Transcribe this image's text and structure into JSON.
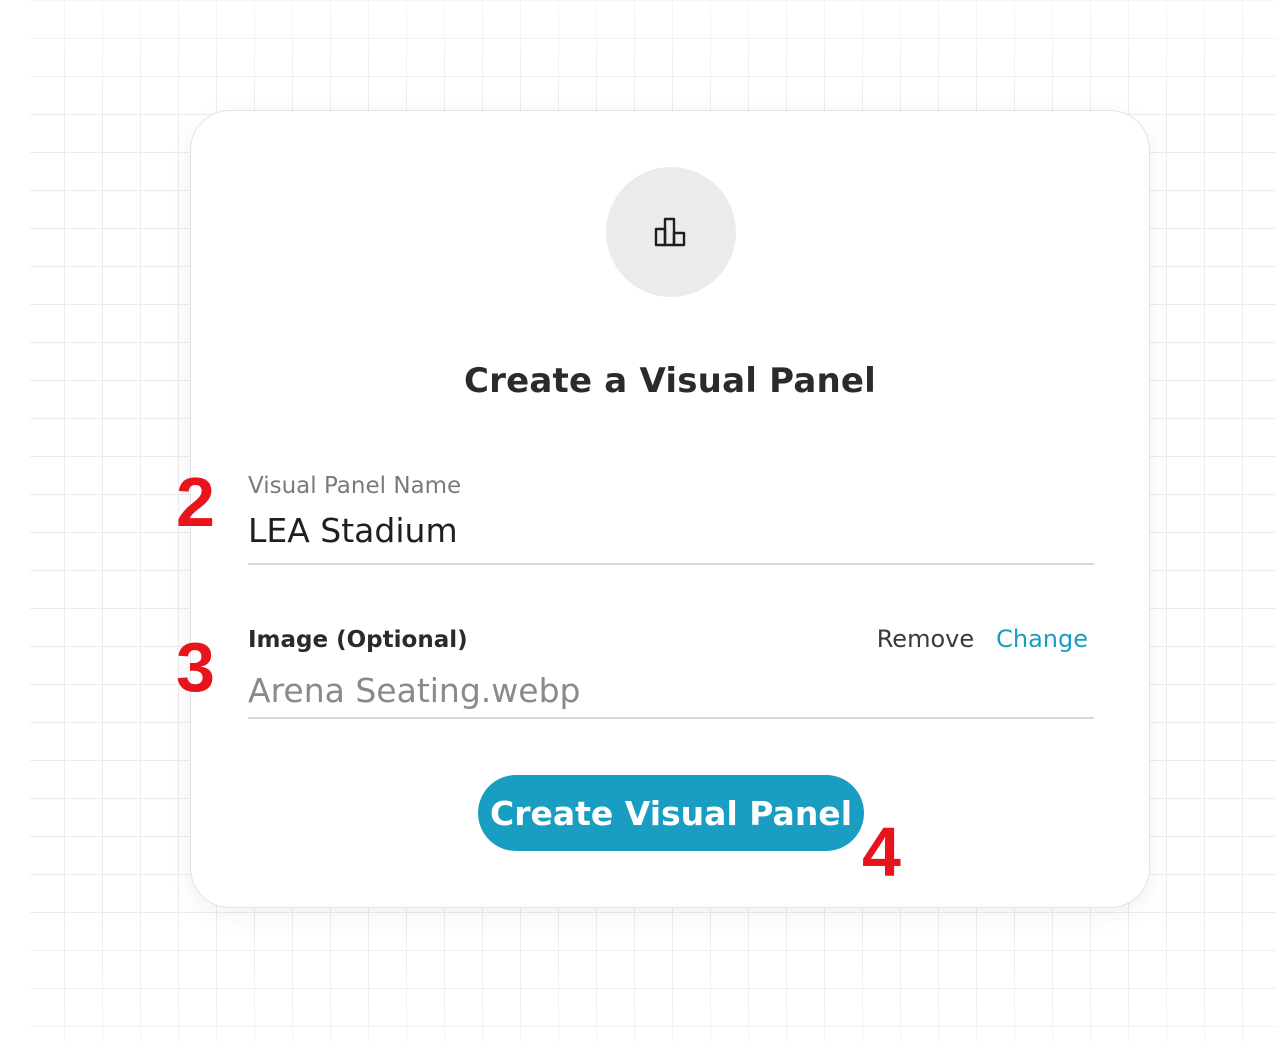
{
  "dialog": {
    "icon": "bar-chart-icon",
    "title": "Create a Visual Panel",
    "name_field": {
      "label": "Visual Panel Name",
      "value": "LEA Stadium"
    },
    "image_field": {
      "label": "Image (Optional)",
      "value": "Arena Seating.webp",
      "remove_label": "Remove",
      "change_label": "Change"
    },
    "submit_label": "Create Visual Panel"
  },
  "step_markers": {
    "name": "2",
    "image": "3",
    "submit": "4"
  },
  "colors": {
    "accent": "#1a9dc2",
    "marker": "#e8141c",
    "icon_bg": "#ebebeb"
  }
}
